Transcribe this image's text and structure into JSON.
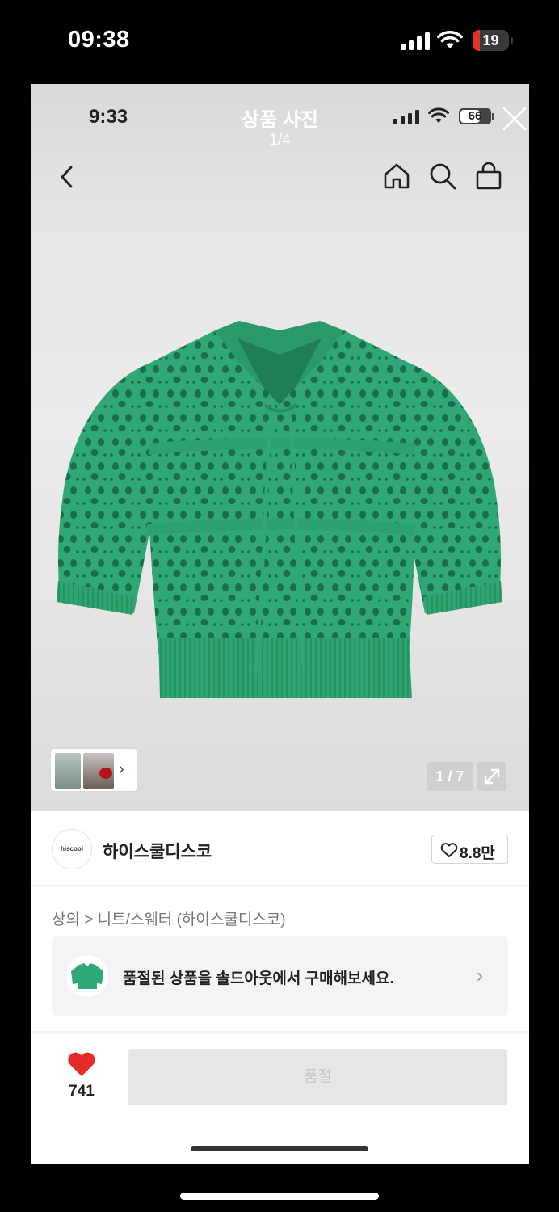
{
  "device": {
    "time": "09:38",
    "battery": "19",
    "battery_level": 0.19,
    "battery_color": "#e0342b"
  },
  "viewer": {
    "title": "상품 사진",
    "counter": "1/4",
    "close_icon": "close-icon"
  },
  "inner_status": {
    "time": "9:33",
    "battery": "66",
    "battery_level": 0.66
  },
  "nav": {
    "back_icon": "chevron-left-icon",
    "home_icon": "home-icon",
    "search_icon": "search-icon",
    "bag_icon": "shopping-bag-icon"
  },
  "gallery": {
    "image_counter": "1 / 7",
    "product_color": "#2fa876",
    "expand_icon": "expand-icon",
    "thumb_chevron": "›"
  },
  "brand": {
    "logo_text": "hiscool",
    "name": "하이스쿨디스코",
    "like_count": "8.8만"
  },
  "breadcrumb": "상의 > 니트/스웨터 (하이스쿨디스코)",
  "soldout_banner": {
    "text": "품절된 상품을 솔드아웃에서 구매해보세요.",
    "chevron": "›"
  },
  "bottom_bar": {
    "heart_count": "741",
    "heart_color": "#e32b2b",
    "buy_label": "품절"
  }
}
